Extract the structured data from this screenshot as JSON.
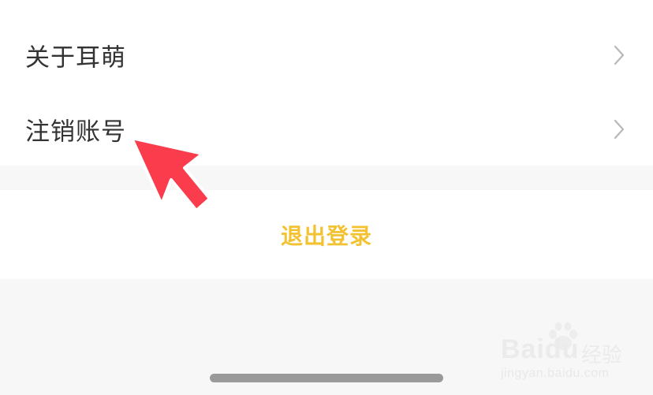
{
  "settings_menu": {
    "items": [
      {
        "label": "关于耳萌",
        "icon": "chevron-right-icon"
      },
      {
        "label": "注销账号",
        "icon": "chevron-right-icon"
      }
    ]
  },
  "logout": {
    "label": "退出登录",
    "color": "#f2c230"
  },
  "annotation": {
    "icon": "red-arrow-pointer",
    "color": "#fa3c4c"
  },
  "watermark": {
    "brand": "Baidu",
    "suffix": "经验",
    "url": "jingyan.baidu.com",
    "icon": "paw-icon"
  }
}
